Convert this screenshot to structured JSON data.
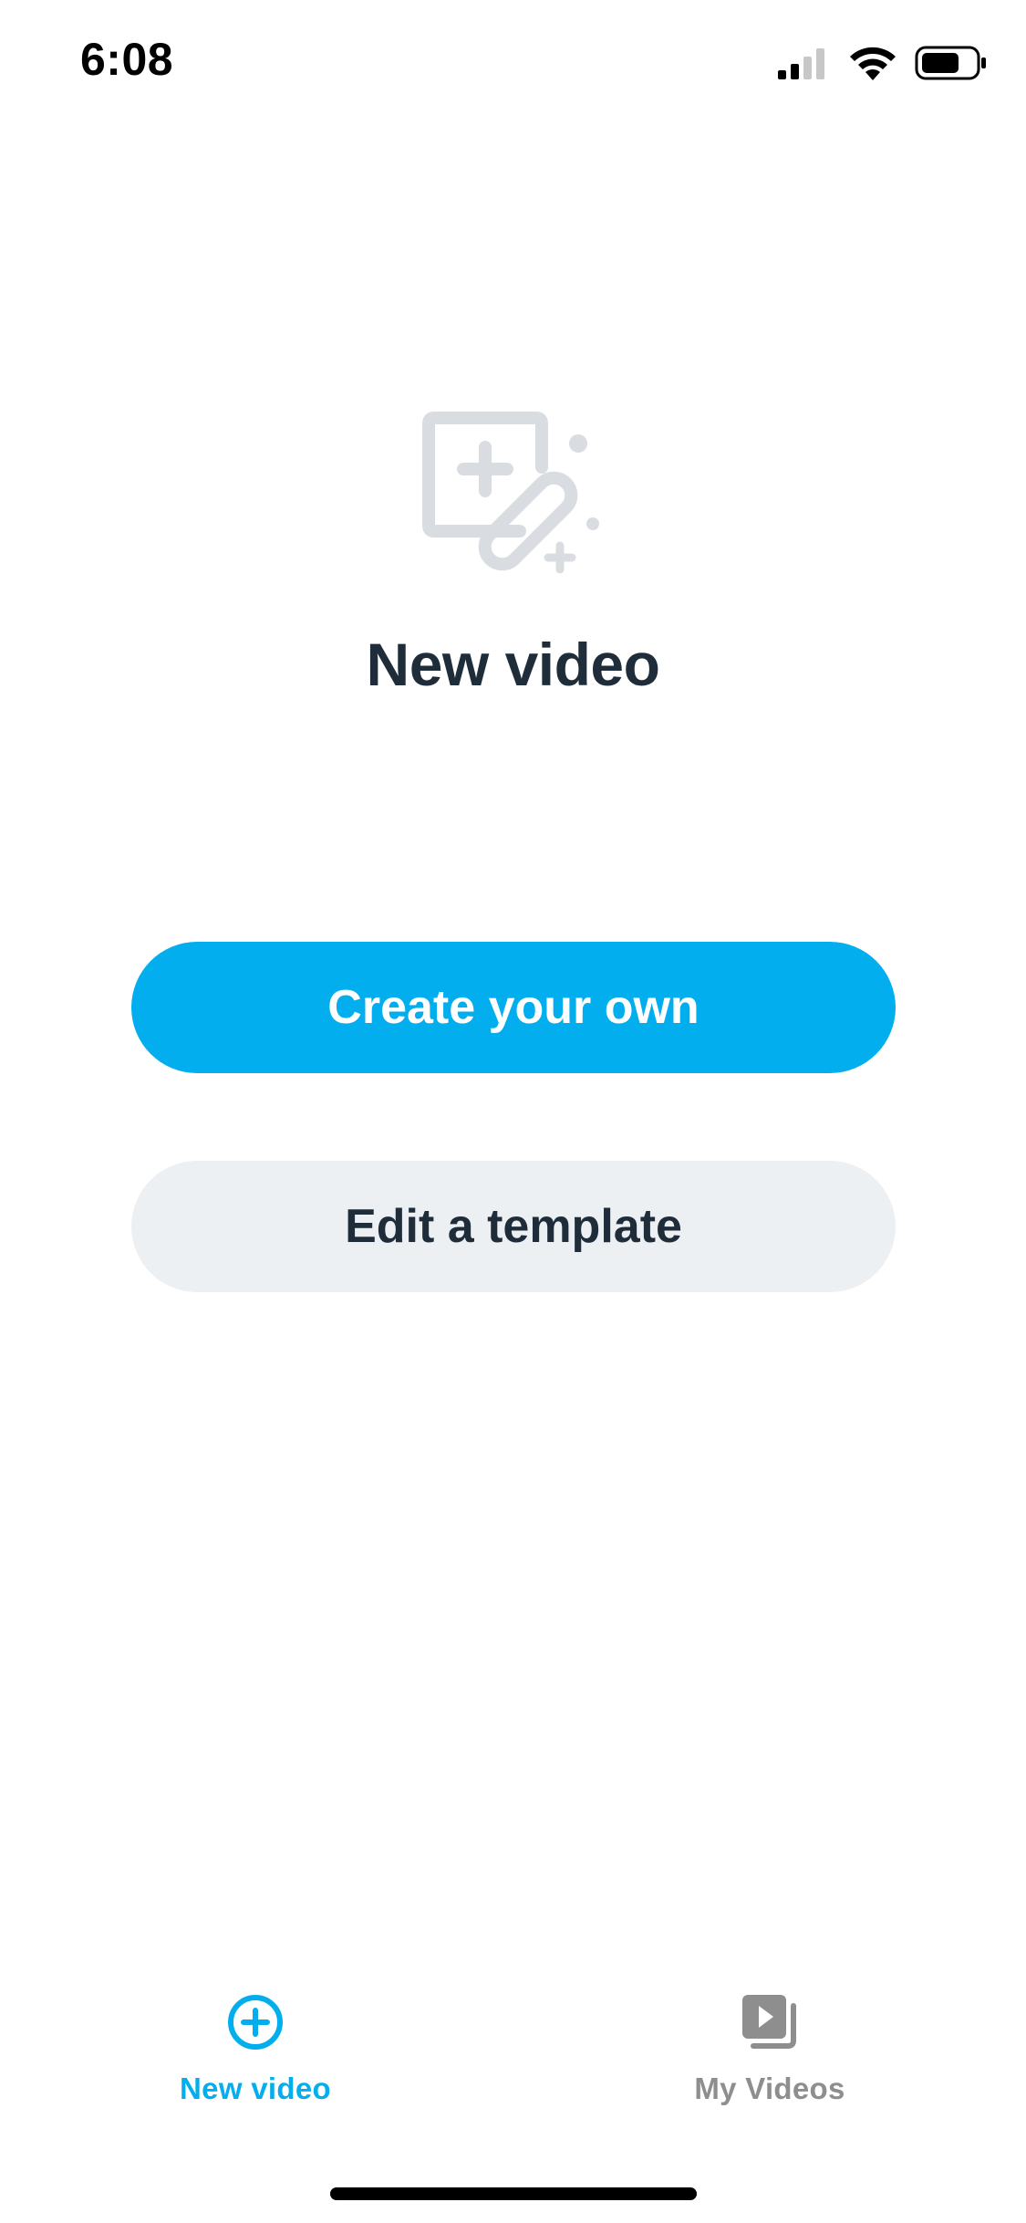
{
  "status_bar": {
    "time": "6:08"
  },
  "hero": {
    "icon": "magic-wand-edit-icon",
    "title": "New video"
  },
  "actions": {
    "create_label": "Create your own",
    "template_label": "Edit a template"
  },
  "tab_bar": {
    "tabs": [
      {
        "label": "New video",
        "icon": "plus-circle-icon",
        "active": true
      },
      {
        "label": "My Videos",
        "icon": "video-library-icon",
        "active": false
      }
    ]
  },
  "colors": {
    "accent": "#03aeee",
    "title_text": "#1f2d3a",
    "secondary_button_bg": "#edf0f3",
    "inactive_tab": "#8e8e8e",
    "hero_icon": "#d9dde1"
  }
}
